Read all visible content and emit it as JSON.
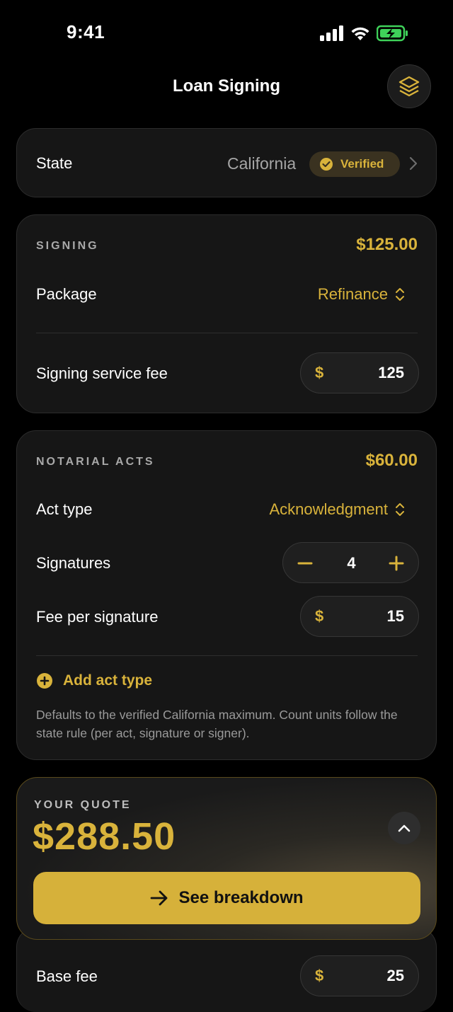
{
  "status_bar": {
    "time": "9:41"
  },
  "nav": {
    "title": "Loan Signing",
    "layers_icon": "layers-icon"
  },
  "state_row": {
    "label": "State",
    "value": "California",
    "badge": "Verified"
  },
  "signing": {
    "title": "SIGNING",
    "total": "$125.00",
    "package_label": "Package",
    "package_value": "Refinance",
    "fee_label": "Signing service fee",
    "currency": "$",
    "fee_value": "125"
  },
  "notarial": {
    "title": "NOTARIAL ACTS",
    "total": "$60.00",
    "act_type_label": "Act type",
    "act_type_value": "Acknowledgment",
    "signatures_label": "Signatures",
    "signatures_value": "4",
    "fee_per_label": "Fee per signature",
    "currency": "$",
    "fee_per_value": "15",
    "add_label": "Add act type",
    "note": "Defaults to the verified California maximum. Count units follow the state rule (per act, signature or signer)."
  },
  "quote": {
    "label": "YOUR QUOTE",
    "amount": "$288.50",
    "cta": "See breakdown"
  },
  "base_fee": {
    "label": "Base fee",
    "currency": "$",
    "value": "25"
  },
  "colors": {
    "accent": "#d9b33b",
    "background": "#000000",
    "card": "#161616"
  }
}
